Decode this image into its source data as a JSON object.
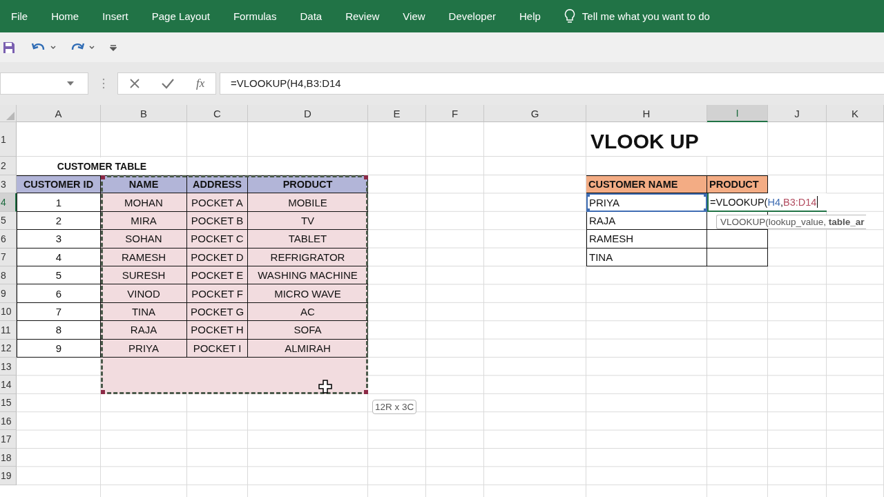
{
  "ribbon_tabs": [
    "File",
    "Home",
    "Insert",
    "Page Layout",
    "Formulas",
    "Data",
    "Review",
    "View",
    "Developer",
    "Help"
  ],
  "tell_me": "Tell me what you want to do",
  "formula_bar": {
    "insert_function": "fx",
    "formula": "=VLOOKUP(H4,B3:D14"
  },
  "columns": [
    {
      "label": "A",
      "selected": false
    },
    {
      "label": "B",
      "selected": false
    },
    {
      "label": "C",
      "selected": false
    },
    {
      "label": "D",
      "selected": false
    },
    {
      "label": "E",
      "selected": false
    },
    {
      "label": "F",
      "selected": false
    },
    {
      "label": "G",
      "selected": false
    },
    {
      "label": "H",
      "selected": false
    },
    {
      "label": "I",
      "selected": true
    },
    {
      "label": "J",
      "selected": false
    },
    {
      "label": "K",
      "selected": false
    }
  ],
  "rows": [
    {
      "label": "1",
      "selected": false
    },
    {
      "label": "2",
      "selected": false
    },
    {
      "label": "3",
      "selected": false
    },
    {
      "label": "4",
      "selected": true
    },
    {
      "label": "5",
      "selected": false
    },
    {
      "label": "6",
      "selected": false
    },
    {
      "label": "7",
      "selected": false
    },
    {
      "label": "8",
      "selected": false
    },
    {
      "label": "9",
      "selected": false
    },
    {
      "label": "10",
      "selected": false
    },
    {
      "label": "11",
      "selected": false
    },
    {
      "label": "12",
      "selected": false
    },
    {
      "label": "13",
      "selected": false
    },
    {
      "label": "14",
      "selected": false
    },
    {
      "label": "15",
      "selected": false
    },
    {
      "label": "16",
      "selected": false
    },
    {
      "label": "17",
      "selected": false
    },
    {
      "label": "18",
      "selected": false
    },
    {
      "label": "19",
      "selected": false
    }
  ],
  "title": "VLOOK UP",
  "customer_table": {
    "caption": "CUSTOMER TABLE",
    "columns": [
      "CUSTOMER ID",
      "NAME",
      "ADDRESS",
      "PRODUCT"
    ],
    "rows": [
      [
        "1",
        "MOHAN",
        "POCKET A",
        "MOBILE"
      ],
      [
        "2",
        "MIRA",
        "POCKET B",
        "TV"
      ],
      [
        "3",
        "SOHAN",
        "POCKET C",
        "TABLET"
      ],
      [
        "4",
        "RAMESH",
        "POCKET D",
        "REFRIGRATOR"
      ],
      [
        "5",
        "SURESH",
        "POCKET E",
        "WASHING MACHINE"
      ],
      [
        "6",
        "VINOD",
        "POCKET F",
        "MICRO WAVE"
      ],
      [
        "7",
        "TINA",
        "POCKET G",
        "AC"
      ],
      [
        "8",
        "RAJA",
        "POCKET H",
        "SOFA"
      ],
      [
        "9",
        "PRIYA",
        "POCKET I",
        "ALMIRAH"
      ]
    ]
  },
  "lookup_table": {
    "columns": [
      "CUSTOMER NAME",
      "PRODUCT"
    ],
    "rows": [
      {
        "name": "PRIYA",
        "product_formula": [
          {
            "text": "=VLOOKUP("
          },
          {
            "text": "H4",
            "color": "#3f6db3"
          },
          {
            "text": ","
          },
          {
            "text": "B3:D14",
            "color": "#b24a5e"
          }
        ]
      },
      {
        "name": "RAJA"
      },
      {
        "name": "RAMESH"
      },
      {
        "name": "TINA"
      }
    ]
  },
  "function_tooltip": "VLOOKUP(lookup_value, **table_ar**",
  "range_tooltip": "12R x 3C"
}
